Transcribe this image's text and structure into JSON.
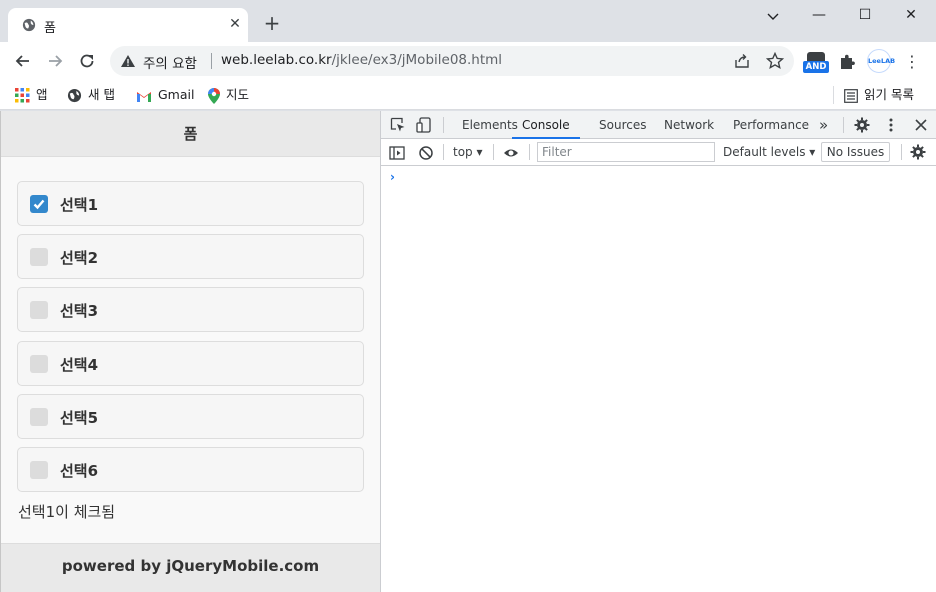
{
  "browser": {
    "tab_title": "폼",
    "tab_close": "✕",
    "new_tab": "+",
    "window_controls": {
      "minimize": "—",
      "maximize": "☐",
      "close": "✕"
    },
    "security_label": "주의 요함",
    "url_host": "web.leelab.co.kr",
    "url_path": "/jklee/ex3/jMobile08.html",
    "extension_badge": "AND",
    "profile_label": "LeeLAB",
    "menu_glyph": "⋮"
  },
  "bookmarks": {
    "items": [
      {
        "label": "앱",
        "icon": "apps-grid-icon"
      },
      {
        "label": "새 탭",
        "icon": "globe-icon"
      },
      {
        "label": "Gmail",
        "icon": "gmail-icon"
      },
      {
        "label": "지도",
        "icon": "maps-pin-icon"
      }
    ],
    "reading_list": "읽기 목록"
  },
  "page": {
    "header_title": "폼",
    "checkboxes": [
      {
        "label": "선택1",
        "checked": true
      },
      {
        "label": "선택2",
        "checked": false
      },
      {
        "label": "선택3",
        "checked": false
      },
      {
        "label": "선택4",
        "checked": false
      },
      {
        "label": "선택5",
        "checked": false
      },
      {
        "label": "선택6",
        "checked": false
      }
    ],
    "status_text": "선택1이 체크됨",
    "footer_text": "powered by jQueryMobile.com"
  },
  "devtools": {
    "tabs": [
      "Elements",
      "Console",
      "Sources",
      "Network",
      "Performance"
    ],
    "active_tab": "Console",
    "more_tabs": "»",
    "context": "top",
    "filter_placeholder": "Filter",
    "levels_label": "Default levels",
    "issues_label": "No Issues",
    "prompt": "›"
  },
  "colors": {
    "accent": "#1a73e8",
    "checkbox_checked": "#3388cc",
    "checkbox_unchecked": "#dcdcdc",
    "jqm_bar": "#e9e9e9"
  }
}
